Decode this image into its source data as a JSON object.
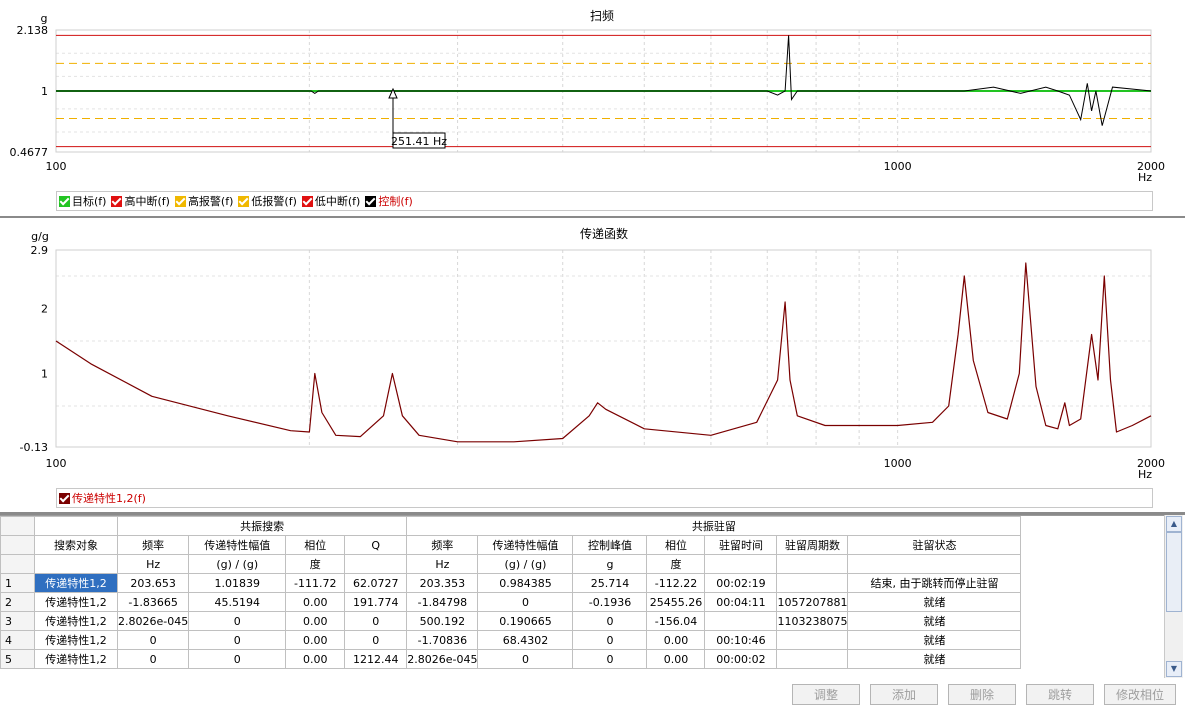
{
  "sweep_chart": {
    "title": "扫频",
    "y_unit": "g",
    "x_unit": "Hz",
    "y_ticks": [
      "2.138",
      "1",
      "0.4677"
    ],
    "x_ticks": [
      "100",
      "1000",
      "2000"
    ],
    "cursor_label": "251.41 Hz",
    "legend": [
      {
        "label": "目标(f)",
        "color": "#22c422",
        "label_color": "#000000"
      },
      {
        "label": "高中断(f)",
        "color": "#e01010",
        "label_color": "#000000"
      },
      {
        "label": "高报警(f)",
        "color": "#f0b800",
        "label_color": "#000000"
      },
      {
        "label": "低报警(f)",
        "color": "#f0b800",
        "label_color": "#000000"
      },
      {
        "label": "低中断(f)",
        "color": "#e01010",
        "label_color": "#000000"
      },
      {
        "label": "控制(f)",
        "color": "#000000",
        "label_color": "#cc0000"
      }
    ]
  },
  "tf_chart": {
    "title": "传递函数",
    "y_unit": "g/g",
    "x_unit": "Hz",
    "y_ticks": [
      "2.9",
      "2",
      "1",
      "-0.13"
    ],
    "x_ticks": [
      "100",
      "1000",
      "2000"
    ],
    "legend": [
      {
        "label": "传递特性1,2(f)",
        "color": "#7a0000",
        "label_color": "#cc0000"
      }
    ]
  },
  "chart_data": [
    {
      "type": "line",
      "title": "扫频",
      "xlabel": "Hz",
      "ylabel": "g",
      "xlim": [
        100,
        2000
      ],
      "ylim": [
        0.4677,
        2.138
      ],
      "x_scale": "log",
      "y_scale": "log",
      "grid": true,
      "legend_position": "bottom",
      "series": [
        {
          "name": "高中断(f)",
          "x": [
            100,
            2000
          ],
          "values": [
            2.0,
            2.0
          ]
        },
        {
          "name": "高报警(f)",
          "x": [
            100,
            2000
          ],
          "values": [
            1.41,
            1.41
          ]
        },
        {
          "name": "低报警(f)",
          "x": [
            100,
            2000
          ],
          "values": [
            0.71,
            0.71
          ]
        },
        {
          "name": "低中断(f)",
          "x": [
            100,
            2000
          ],
          "values": [
            0.5,
            0.5
          ]
        },
        {
          "name": "目标(f)",
          "x": [
            100,
            2000
          ],
          "values": [
            1,
            1
          ]
        },
        {
          "name": "控制(f)",
          "x": [
            100,
            201,
            203,
            205,
            250,
            700,
            720,
            735,
            742,
            748,
            760,
            900,
            1200,
            1300,
            1400,
            1500,
            1550,
            1600,
            1650,
            1680,
            1700,
            1720,
            1750,
            1800,
            2000
          ],
          "values": [
            1,
            1,
            0.97,
            1,
            1,
            1,
            0.95,
            1.0,
            2.0,
            0.9,
            1.0,
            1,
            1,
            1.05,
            0.97,
            1.05,
            1.0,
            0.95,
            0.7,
            1.1,
            0.78,
            1.0,
            0.65,
            1.05,
            1
          ]
        }
      ]
    },
    {
      "type": "line",
      "title": "传递函数",
      "xlabel": "Hz",
      "ylabel": "g/g",
      "xlim": [
        100,
        2000
      ],
      "ylim": [
        -0.13,
        2.9
      ],
      "x_scale": "log",
      "grid": true,
      "legend_position": "bottom",
      "series": [
        {
          "name": "传递特性1,2(f)",
          "x": [
            100,
            110,
            130,
            160,
            190,
            200,
            203,
            207,
            215,
            230,
            245,
            251,
            258,
            270,
            300,
            350,
            400,
            430,
            440,
            450,
            500,
            600,
            680,
            720,
            735,
            745,
            760,
            820,
            900,
            1000,
            1100,
            1150,
            1180,
            1200,
            1230,
            1280,
            1350,
            1395,
            1420,
            1460,
            1500,
            1550,
            1580,
            1600,
            1650,
            1700,
            1730,
            1760,
            1790,
            1820,
            1900,
            2000
          ],
          "values": [
            1.5,
            1.15,
            0.65,
            0.35,
            0.12,
            0.1,
            1.0,
            0.4,
            0.05,
            0.03,
            0.35,
            1.0,
            0.35,
            0.05,
            -0.05,
            -0.05,
            0.0,
            0.35,
            0.55,
            0.45,
            0.15,
            0.05,
            0.25,
            0.9,
            2.1,
            0.9,
            0.35,
            0.2,
            0.2,
            0.2,
            0.25,
            0.5,
            1.6,
            2.5,
            1.2,
            0.4,
            0.3,
            1.0,
            2.7,
            0.8,
            0.2,
            0.15,
            0.55,
            0.2,
            0.3,
            1.6,
            0.9,
            2.5,
            0.9,
            0.1,
            0.2,
            0.35
          ]
        }
      ]
    }
  ],
  "table": {
    "group_headers": {
      "search": "共振搜索",
      "dwell": "共振驻留"
    },
    "headers": [
      "搜索对象",
      "频率",
      "传递特性幅值",
      "相位",
      "Q",
      "频率",
      "传递特性幅值",
      "控制峰值",
      "相位",
      "驻留时间",
      "驻留周期数",
      "驻留状态"
    ],
    "units": [
      "",
      "Hz",
      "(g) / (g)",
      "度",
      "",
      "Hz",
      "(g) / (g)",
      "g",
      "度",
      "",
      "",
      ""
    ],
    "rows": [
      {
        "num": "1",
        "cells": [
          "传递特性1,2",
          "203.653",
          "1.01839",
          "-111.72",
          "62.0727",
          "203.353",
          "0.984385",
          "25.714",
          "-112.22",
          "00:02:19",
          "",
          "结束, 由于跳转而停止驻留"
        ]
      },
      {
        "num": "2",
        "cells": [
          "传递特性1,2",
          "-1.83665",
          "45.5194",
          "0.00",
          "191.774",
          "-1.84798",
          "0",
          "-0.1936",
          "25455.26",
          "00:04:11",
          "1057207881",
          "就绪"
        ]
      },
      {
        "num": "3",
        "cells": [
          "传递特性1,2",
          "2.8026e-045",
          "0",
          "0.00",
          "0",
          "500.192",
          "0.190665",
          "0",
          "-156.04",
          "",
          "1103238075",
          "就绪"
        ]
      },
      {
        "num": "4",
        "cells": [
          "传递特性1,2",
          "0",
          "0",
          "0.00",
          "0",
          "-1.70836",
          "68.4302",
          "0",
          "0.00",
          "00:10:46",
          "",
          "就绪"
        ]
      },
      {
        "num": "5",
        "cells": [
          "传递特性1,2",
          "0",
          "0",
          "0.00",
          "1212.44",
          "2.8026e-045",
          "0",
          "0",
          "0.00",
          "00:00:02",
          "",
          "就绪"
        ]
      }
    ]
  },
  "buttons": {
    "adjust": "调整",
    "add": "添加",
    "delete": "删除",
    "jump": "跳转",
    "modify_phase": "修改相位"
  }
}
